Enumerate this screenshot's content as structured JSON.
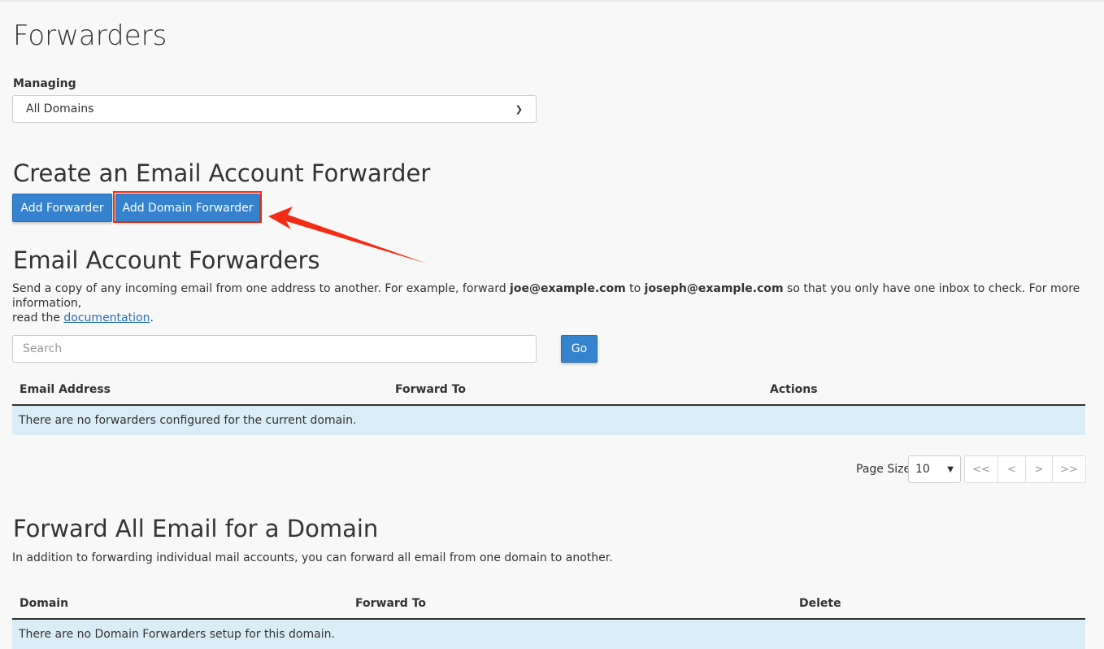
{
  "page": {
    "title": "Forwarders"
  },
  "managing": {
    "label": "Managing",
    "selected": "All Domains"
  },
  "create": {
    "heading": "Create an Email Account Forwarder",
    "add_forwarder": "Add Forwarder",
    "add_domain_forwarder": "Add Domain Forwarder"
  },
  "annotation": {
    "color": "#f42b15"
  },
  "email_forwarders": {
    "heading": "Email Account Forwarders",
    "desc_1": "Send a copy of any incoming email from one address to another. For example, forward ",
    "example_from": "joe@example.com",
    "desc_2": " to ",
    "example_to": "joseph@example.com",
    "desc_3": " so that you only have one inbox to check. For more information,",
    "desc_4": "read the ",
    "doc_link": "documentation",
    "desc_5": ".",
    "search_placeholder": "Search",
    "go": "Go",
    "columns": [
      "Email Address",
      "Forward To",
      "Actions"
    ],
    "empty": "There are no forwarders configured for the current domain.",
    "page_size_label": "Page Size",
    "page_size": "10",
    "pager": [
      "<<",
      "<",
      ">",
      ">>"
    ]
  },
  "domain_forwarders": {
    "heading": "Forward All Email for a Domain",
    "desc": "In addition to forwarding individual mail accounts, you can forward all email from one domain to another.",
    "columns": [
      "Domain",
      "Forward To",
      "Delete"
    ],
    "empty": "There are no Domain Forwarders setup for this domain."
  },
  "colors": {
    "primary": "#3583ce",
    "info_row": "#d9edf7"
  }
}
